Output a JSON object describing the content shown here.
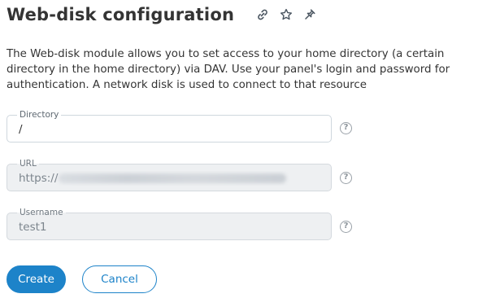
{
  "header": {
    "title": "Web-disk configuration",
    "icons": [
      "link-icon",
      "star-icon",
      "pin-icon"
    ]
  },
  "description": "The Web-disk module allows you to set access to your home directory (a certain directory in the home directory) via DAV. Use your panel's login and password for authentication. A network disk is used to connect to that resource",
  "form": {
    "directory": {
      "label": "Directory",
      "value": "/"
    },
    "url": {
      "label": "URL",
      "value_prefix": "https://"
    },
    "username": {
      "label": "Username",
      "value": "test1"
    },
    "help_glyph": "?"
  },
  "actions": {
    "create_label": "Create",
    "cancel_label": "Cancel"
  },
  "colors": {
    "accent": "#1d83c9",
    "text": "#343434",
    "disabled_bg": "#eef0f2",
    "border": "#cfd7de"
  }
}
